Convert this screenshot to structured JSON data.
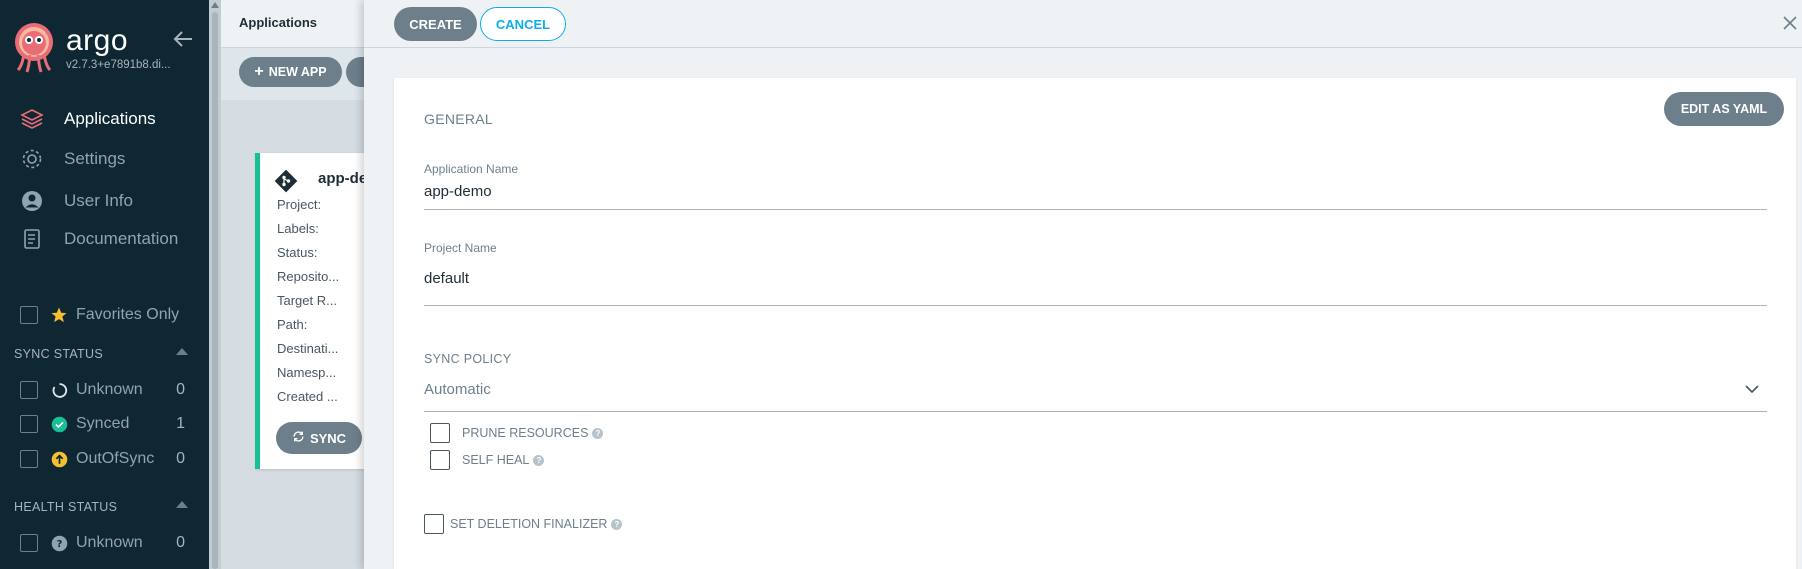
{
  "sidebar": {
    "brand": "argo",
    "version": "v2.7.3+e7891b8.di...",
    "nav": [
      {
        "label": "Applications",
        "icon": "layers-icon"
      },
      {
        "label": "Settings",
        "icon": "gear-icon"
      },
      {
        "label": "User Info",
        "icon": "user-icon"
      },
      {
        "label": "Documentation",
        "icon": "book-icon"
      }
    ],
    "favorites_label": "Favorites Only",
    "sync_status": {
      "title": "SYNC STATUS",
      "items": [
        {
          "label": "Unknown",
          "count": "0",
          "icon": "circle-notch-icon"
        },
        {
          "label": "Synced",
          "count": "1",
          "icon": "check-circle-icon"
        },
        {
          "label": "OutOfSync",
          "count": "0",
          "icon": "arrow-up-circle-icon"
        }
      ]
    },
    "health_status": {
      "title": "HEALTH STATUS",
      "items": [
        {
          "label": "Unknown",
          "count": "0",
          "icon": "question-circle-icon"
        }
      ]
    }
  },
  "background": {
    "page_title": "Applications",
    "new_app_label": "NEW APP",
    "app_card": {
      "name": "app-de",
      "fields": [
        "Project:",
        "Labels:",
        "Status:",
        "Reposito...",
        "Target R...",
        "Path:",
        "Destinati...",
        "Namesp...",
        "Created ..."
      ],
      "sync_label": "SYNC"
    }
  },
  "panel": {
    "create_label": "CREATE",
    "cancel_label": "CANCEL",
    "edit_yaml_label": "EDIT AS YAML",
    "general_title": "GENERAL",
    "app_name_label": "Application Name",
    "app_name_value": "app-demo",
    "project_label": "Project Name",
    "project_value": "default",
    "sync_policy_title": "SYNC POLICY",
    "sync_policy_value": "Automatic",
    "prune_label": "PRUNE RESOURCES",
    "self_heal_label": "SELF HEAL",
    "deletion_finalizer_label": "SET DELETION FINALIZER",
    "help_glyph": "?"
  },
  "colors": {
    "sidebar_bg": "#0f2733",
    "accent_teal": "#0dadea",
    "synced_green": "#18be94",
    "outofsync_yellow": "#f4c030",
    "button_gray": "#6d7f8b",
    "logo_orange": "#e96d76"
  }
}
